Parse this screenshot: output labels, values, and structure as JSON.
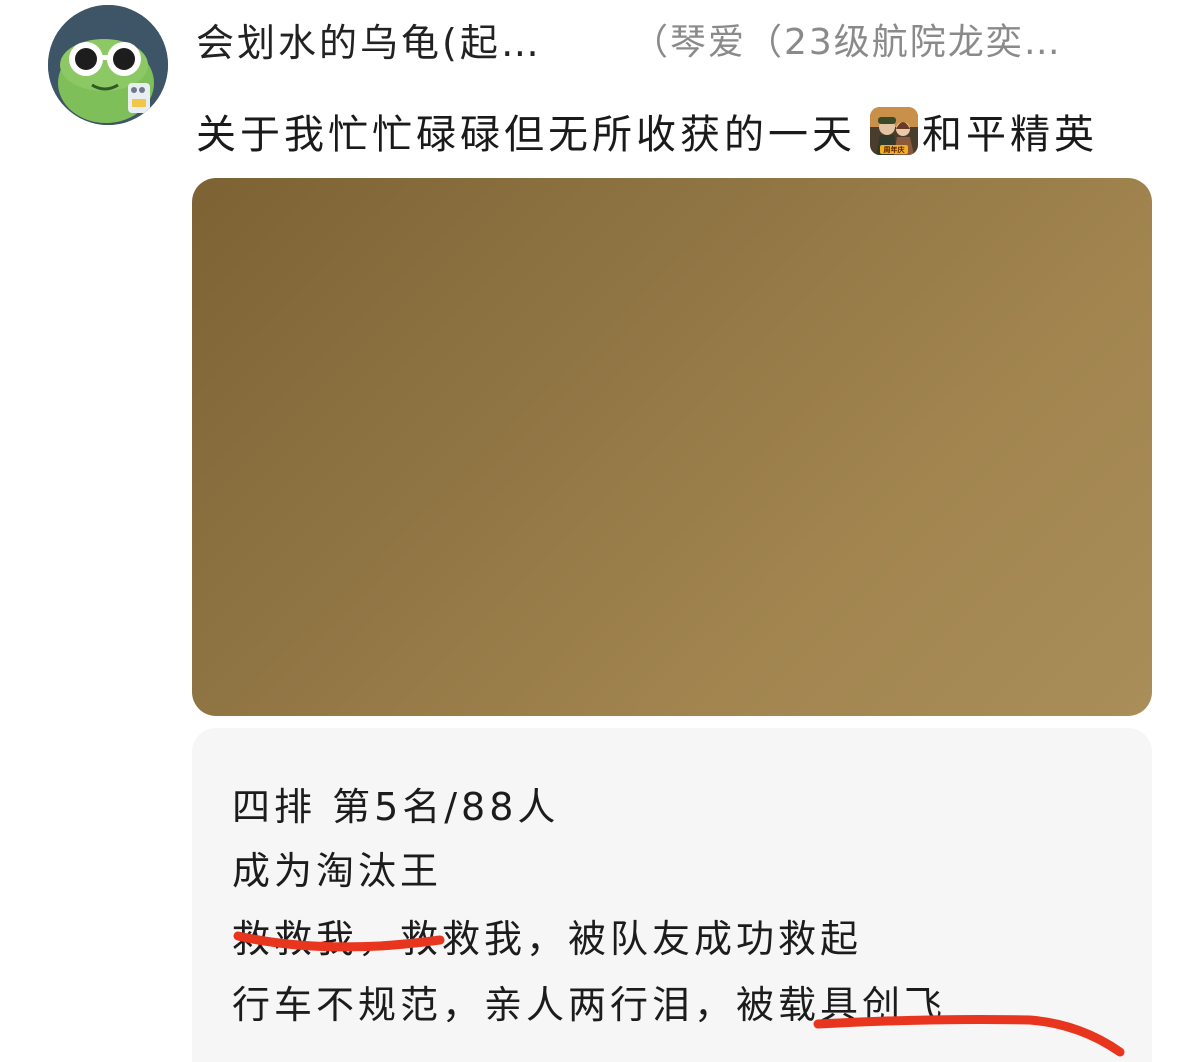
{
  "post": {
    "author_name": "会划水的乌龟(起…",
    "group_tag": "（琴爱（23级航院龙奕…",
    "title": "关于我忙忙碌碌但无所收获的一天",
    "game_name": "和平精英",
    "game_icon_badge": "周年庆",
    "body_lines": [
      "四排 第5名/88人",
      "成为淘汰王",
      "救救我，救救我，被队友成功救起",
      "行车不规范，亲人两行泪，被载具创飞"
    ]
  },
  "colors": {
    "accent_underline": "#e8361e",
    "avatar_bg": "#3d5567",
    "frog_green": "#7fbf5a"
  },
  "icons": {
    "avatar": "frog-with-sunglasses-icon",
    "game": "pubg-mobile-icon",
    "annotation": "red-underline-stroke"
  }
}
